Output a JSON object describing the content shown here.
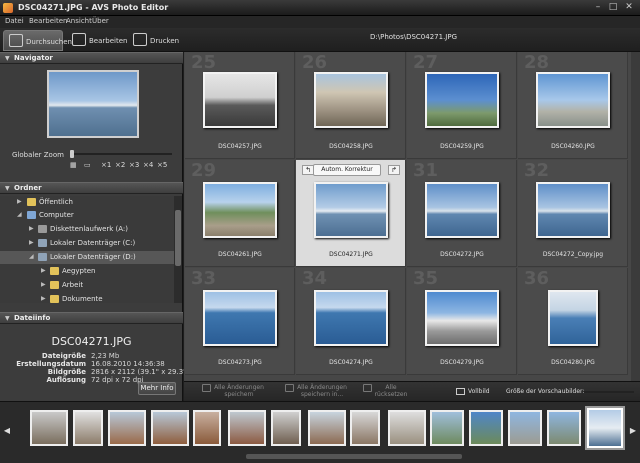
{
  "window": {
    "title": "DSC04271.JPG  -  AVS Photo Editor",
    "min_icon": "minimize-icon",
    "max_icon": "maximize-icon",
    "close_icon": "close-icon"
  },
  "menu": [
    "Datei",
    "Bearbeiten",
    "Ansicht",
    "Über"
  ],
  "modes": [
    {
      "label": "Durchsuchen",
      "icon": "browse-icon"
    },
    {
      "label": "Bearbeiten",
      "icon": "edit-icon"
    },
    {
      "label": "Drucken",
      "icon": "print-icon"
    }
  ],
  "path": "D:\\Photos\\DSC04271.JPG",
  "navigator": {
    "header": "Navigator",
    "zoom_label": "Globaler Zoom",
    "zoom_options": [
      "×1",
      "×2",
      "×3",
      "×4",
      "×5"
    ]
  },
  "folder": {
    "header": "Ordner",
    "items": [
      {
        "label": "Öffentlich",
        "icon": "folder-icon"
      },
      {
        "label": "Computer",
        "icon": "computer-icon"
      },
      {
        "label": "Diskettenlaufwerk (A:)",
        "icon": "floppy-icon"
      },
      {
        "label": "Lokaler Datenträger (C:)",
        "icon": "drive-icon"
      },
      {
        "label": "Lokaler Datenträger (D:)",
        "icon": "drive-icon"
      },
      {
        "label": "Aegypten",
        "icon": "folder-icon"
      },
      {
        "label": "Arbeit",
        "icon": "folder-icon"
      },
      {
        "label": "Dokumente",
        "icon": "folder-icon"
      }
    ]
  },
  "fileinfo": {
    "header": "Dateiinfo",
    "filename": "DSC04271.JPG",
    "rows": [
      {
        "k": "Dateigröße",
        "v": "2,23 Mb"
      },
      {
        "k": "Erstellungsdatum",
        "v": "16.08.2010  14:36:38"
      },
      {
        "k": "Bildgröße",
        "v": "2816 x 2112 (39.1\" x 29.3\")"
      },
      {
        "k": "Auflösung",
        "v": "72 dpi x 72 dpi"
      }
    ],
    "more_button": "Mehr Info"
  },
  "grid": {
    "autocorrect": "Autom. Korrektur",
    "rotate_left_icon": "rotate-left-icon",
    "rotate_right_icon": "rotate-right-icon",
    "tiles": [
      {
        "num": "25",
        "name": "DSC04257.JPG"
      },
      {
        "num": "26",
        "name": "DSC04258.JPG"
      },
      {
        "num": "27",
        "name": "DSC04259.JPG"
      },
      {
        "num": "28",
        "name": "DSC04260.JPG"
      },
      {
        "num": "29",
        "name": "DSC04261.JPG"
      },
      {
        "num": "30",
        "name": "DSC04271.JPG"
      },
      {
        "num": "31",
        "name": "DSC04272.JPG"
      },
      {
        "num": "32",
        "name": "DSC04272_Copy.jpg"
      },
      {
        "num": "33",
        "name": "DSC04273.JPG"
      },
      {
        "num": "34",
        "name": "DSC04274.JPG"
      },
      {
        "num": "35",
        "name": "DSC04279.JPG"
      },
      {
        "num": "36",
        "name": "DSC04280.JPG"
      }
    ]
  },
  "actions": {
    "save_all": "Alle Änderungen\nspeichern",
    "save_all_in": "Alle Änderungen\nspeichern in...",
    "reset_all": "Alle\nrücksetzen",
    "fullscreen": "Vollbild",
    "thumb_size": "Größe der Vorschaubilder:"
  },
  "colors": {
    "accent": "#dcdcdc",
    "background": "#474747",
    "sidebar": "#3c3c3c"
  }
}
